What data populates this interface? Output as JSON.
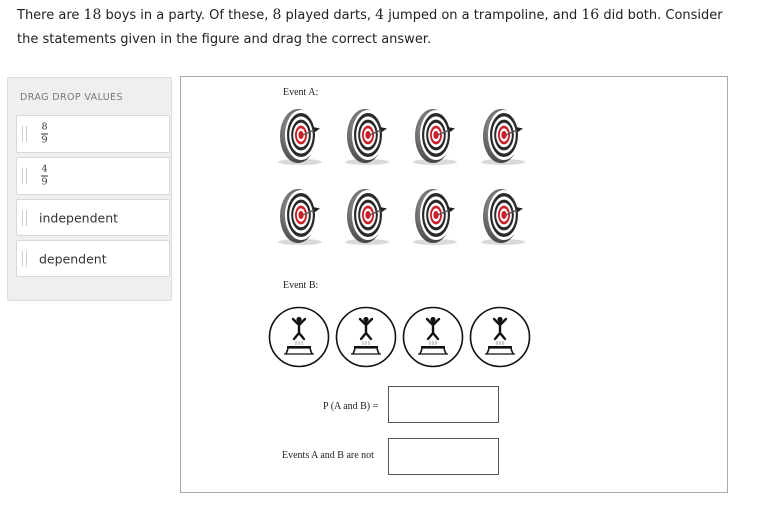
{
  "question": {
    "t1": "There are ",
    "n_boys": "18",
    "t2": " boys in a party. Of these, ",
    "n_darts": "8",
    "t3": " played darts, ",
    "n_tramp": "4",
    "t4": " jumped on a trampoline, and ",
    "n_both": "16",
    "t5": " did both. Consider the statements given in the figure and drag the correct answer."
  },
  "palette": {
    "title": "DRAG DROP VALUES",
    "chips": [
      {
        "type": "fraction",
        "numerator": "8",
        "denominator": "9"
      },
      {
        "type": "fraction",
        "numerator": "4",
        "denominator": "9"
      },
      {
        "type": "text",
        "label": "independent"
      },
      {
        "type": "text",
        "label": "dependent"
      }
    ]
  },
  "figure": {
    "event_a_label": "Event A:",
    "event_b_label": "Event B:",
    "dartboard_icon": "dartboard-icon",
    "dartboard_count": 8,
    "trampoline_icon": "trampoline-icon",
    "trampoline_count": 4,
    "p_a_and_b_label": "P (A and B) =",
    "events_not_label": "Events A and B are not"
  },
  "colors": {
    "ring_red": "#cc1f2a",
    "ring_dark": "#2a2a2a",
    "panel_bg": "#efefef",
    "border": "#a8a8a8"
  }
}
